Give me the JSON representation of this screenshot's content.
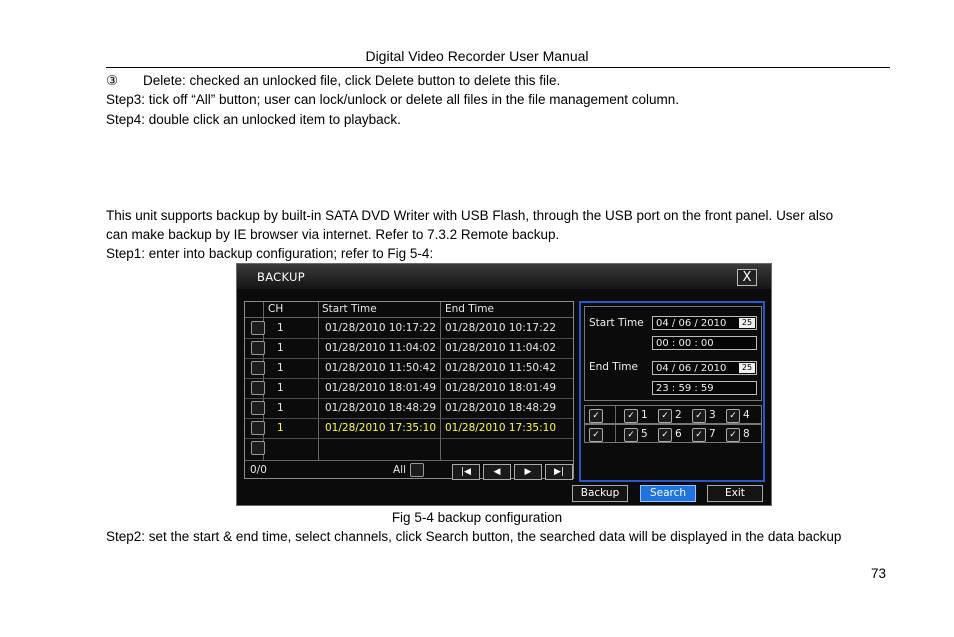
{
  "header": {
    "title": "Digital Video Recorder User Manual"
  },
  "body": {
    "line1_mark": "③",
    "line1_text": "Delete: checked an unlocked file, click Delete button to delete this file.",
    "line2": "Step3: tick off “All” button; user can lock/unlock or delete all files in the file management column.",
    "line3": "Step4: double click an unlocked item to playback.",
    "para1_a": "This unit supports backup by built-in SATA DVD Writer with USB Flash, through the USB port on the front panel. User also",
    "para1_b": "can make backup by IE browser via internet. Refer to 7.3.2 Remote backup.",
    "step1": "Step1: enter into backup configuration; refer to Fig 5-4:",
    "caption": "Fig 5-4 backup configuration",
    "step2": "Step2: set the start & end time, select channels, click Search button, the searched data will be displayed in the data backup",
    "page_number": "73"
  },
  "dvr": {
    "title": "BACKUP",
    "close_label": "X",
    "columns": [
      "CH",
      "Start Time",
      "End Time"
    ],
    "rows": [
      {
        "ch": "1",
        "start": "01/28/2010  10:17:22",
        "end": "01/28/2010  10:17:22"
      },
      {
        "ch": "1",
        "start": "01/28/2010  11:04:02",
        "end": "01/28/2010  11:04:02"
      },
      {
        "ch": "1",
        "start": "01/28/2010  11:50:42",
        "end": "01/28/2010  11:50:42"
      },
      {
        "ch": "1",
        "start": "01/28/2010  18:01:49",
        "end": "01/28/2010  18:01:49"
      },
      {
        "ch": "1",
        "start": "01/28/2010  18:48:29",
        "end": "01/28/2010  18:48:29"
      },
      {
        "ch": "1",
        "start": "01/28/2010  17:35:10",
        "end": "01/28/2010  17:35:10"
      }
    ],
    "highlight_color": "#ffff33",
    "count": "0/0",
    "all_label": "All",
    "nav": {
      "first": "|◀",
      "prev": "◀",
      "next": "▶",
      "last": "▶|"
    },
    "start_label": "Start Time",
    "start_date": "04 / 06 / 2010",
    "start_time": "00  :  00  :  00",
    "end_label": "End Time",
    "end_date": "04 / 06 / 2010",
    "end_time": "23  :  59  :  59",
    "spin_text": "25",
    "check_glyph": "✓",
    "channels_row1": [
      "1",
      "2",
      "3",
      "4"
    ],
    "channels_row2": [
      "5",
      "6",
      "7",
      "8"
    ],
    "buttons": {
      "backup": "Backup",
      "search": "Search",
      "exit": "Exit"
    },
    "accent": "#1f73e0"
  }
}
